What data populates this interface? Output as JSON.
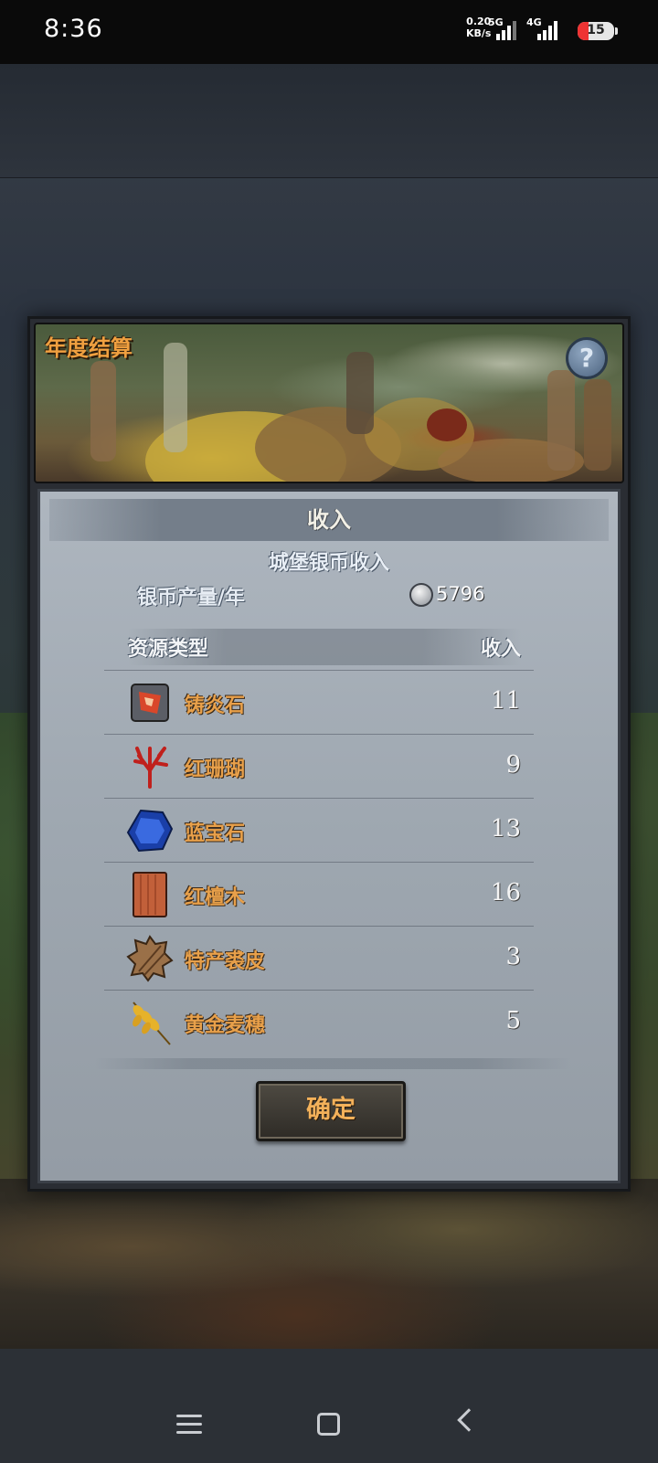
{
  "status_bar": {
    "time": "8:36",
    "net_speed_value": "0.20",
    "net_speed_unit": "KB/s",
    "sim1_label": "5G",
    "sim2_label": "4G",
    "battery": "15"
  },
  "dialog": {
    "banner_title": "年度结算",
    "help_icon": "?",
    "section_title": "收入",
    "subsection_title": "城堡银币收入",
    "silver_rate_label": "银币产量/年",
    "silver_rate_value": "5796",
    "table": {
      "col_type": "资源类型",
      "col_income": "收入",
      "rows": [
        {
          "name": "铸炎石",
          "value": "11",
          "icon": "ember-stone-icon"
        },
        {
          "name": "红珊瑚",
          "value": "9",
          "icon": "red-coral-icon"
        },
        {
          "name": "蓝宝石",
          "value": "13",
          "icon": "sapphire-icon"
        },
        {
          "name": "红檀木",
          "value": "16",
          "icon": "red-sandalwood-icon"
        },
        {
          "name": "特产裘皮",
          "value": "3",
          "icon": "fur-pelt-icon"
        },
        {
          "name": "黄金麦穗",
          "value": "5",
          "icon": "golden-wheat-icon"
        }
      ]
    },
    "confirm_label": "确定"
  },
  "colors": {
    "resource_name": "#e8a04a",
    "banner_title": "#f0a040",
    "confirm_text": "#f3b15a"
  }
}
